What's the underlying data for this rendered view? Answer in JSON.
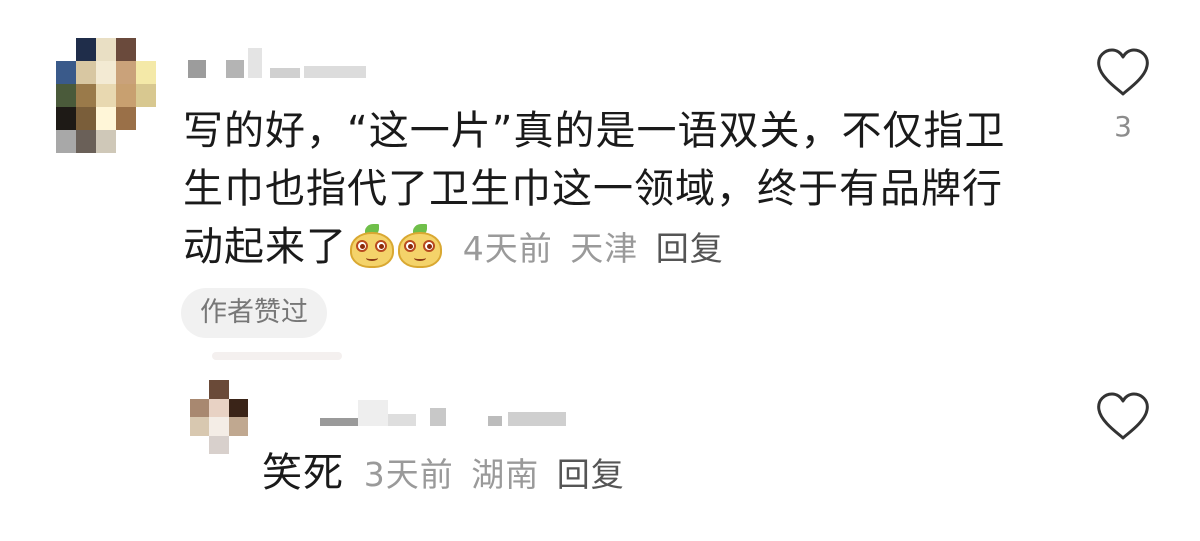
{
  "comments": [
    {
      "text": "写的好，“这一片”真的是一语双关，不仅指卫生巾也指代了卫生巾这一领域，终于有品牌行动起来了",
      "emojis": [
        "mango-face-sticker",
        "mango-face-sticker"
      ],
      "time": "4天前",
      "location": "天津",
      "reply_label": "回复",
      "badge": "作者赞过",
      "like_count": "3"
    },
    {
      "text": "笑死",
      "time": "3天前",
      "location": "湖南",
      "reply_label": "回复"
    }
  ],
  "icons": {
    "like": "heart-outline-icon"
  },
  "colors": {
    "text": "#1a1a1a",
    "meta": "#9a9a9a",
    "badge_bg": "#f1f1f1"
  }
}
